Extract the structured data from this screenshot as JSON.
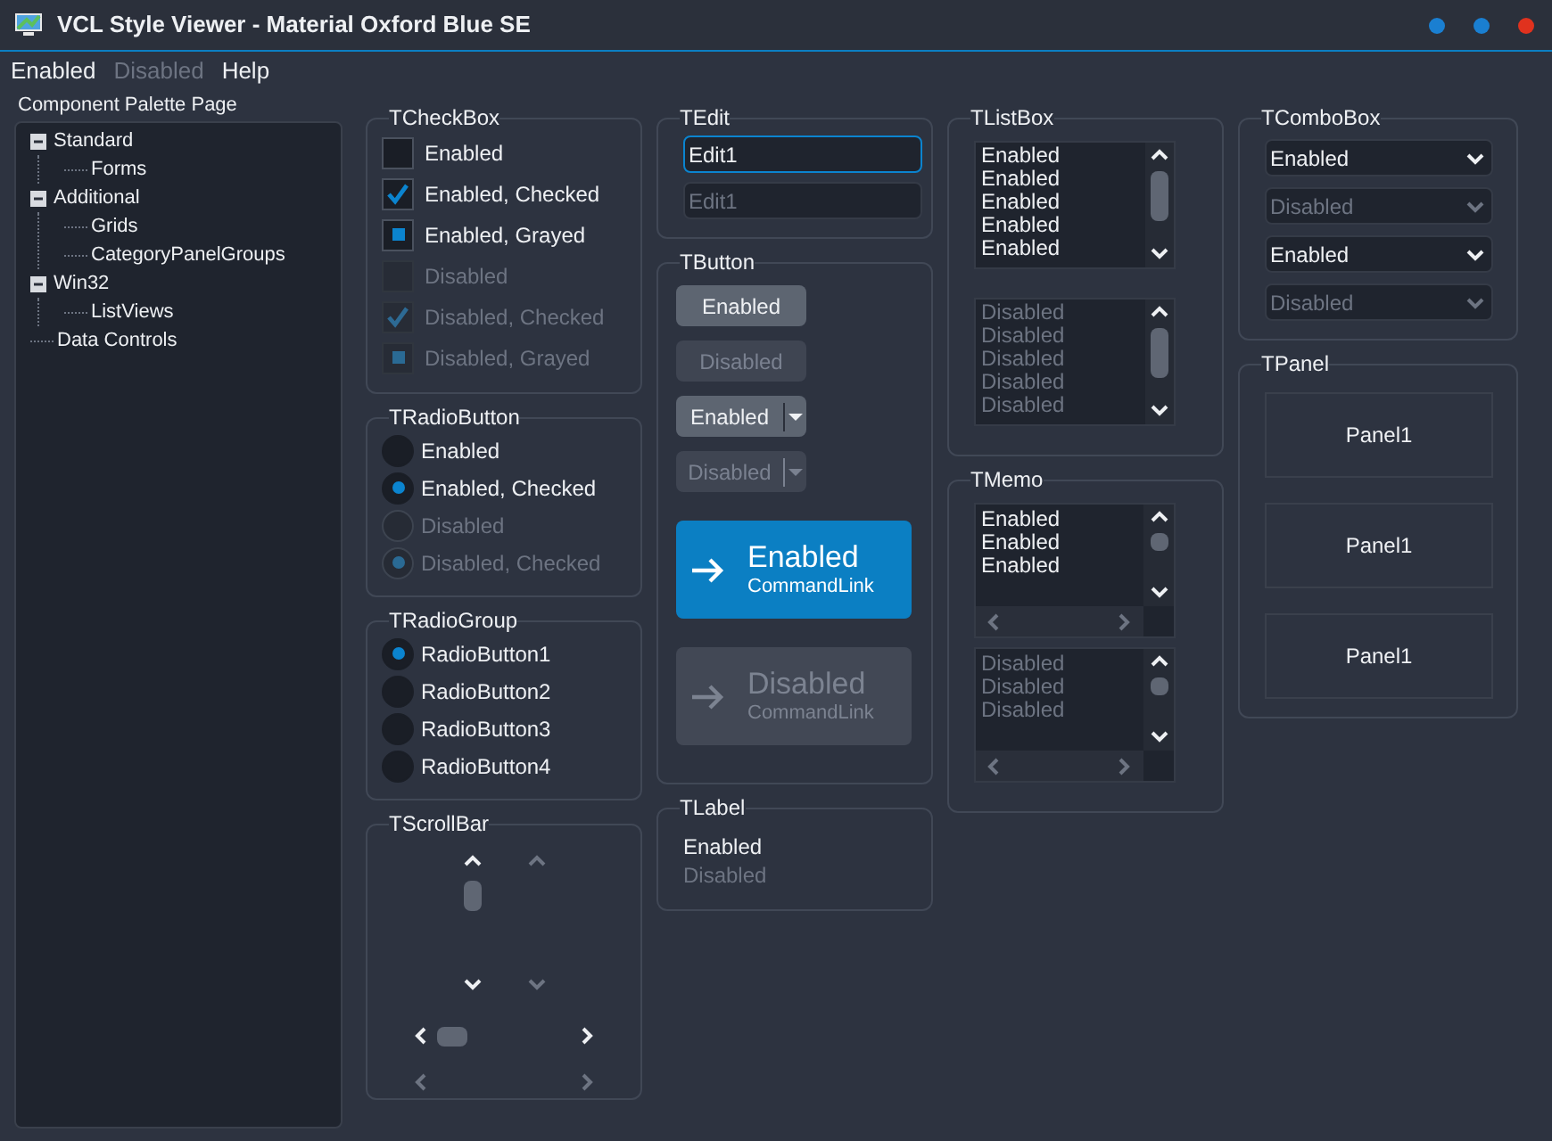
{
  "window": {
    "title": "VCL Style Viewer - Material Oxford Blue SE"
  },
  "menu": [
    {
      "label": "Enabled",
      "disabled": false
    },
    {
      "label": "Disabled",
      "disabled": true
    },
    {
      "label": "Help",
      "disabled": false
    }
  ],
  "palette": {
    "label": "Component Palette Page",
    "tree": [
      {
        "label": "Standard",
        "expanded": true,
        "children": [
          {
            "label": "Forms"
          }
        ]
      },
      {
        "label": "Additional",
        "expanded": true,
        "children": [
          {
            "label": "Grids"
          },
          {
            "label": "CategoryPanelGroups"
          }
        ]
      },
      {
        "label": "Win32",
        "expanded": true,
        "children": [
          {
            "label": "ListViews"
          }
        ]
      },
      {
        "label": "Data Controls"
      }
    ]
  },
  "checkbox_group": {
    "title": "TCheckBox",
    "items": [
      {
        "label": "Enabled",
        "checked": false,
        "grayed": false,
        "disabled": false
      },
      {
        "label": "Enabled, Checked",
        "checked": true,
        "grayed": false,
        "disabled": false
      },
      {
        "label": "Enabled, Grayed",
        "checked": false,
        "grayed": true,
        "disabled": false
      },
      {
        "label": "Disabled",
        "checked": false,
        "grayed": false,
        "disabled": true
      },
      {
        "label": "Disabled, Checked",
        "checked": true,
        "grayed": false,
        "disabled": true
      },
      {
        "label": "Disabled, Grayed",
        "checked": false,
        "grayed": true,
        "disabled": true
      }
    ]
  },
  "radiobutton_group": {
    "title": "TRadioButton",
    "items": [
      {
        "label": "Enabled",
        "checked": false,
        "disabled": false
      },
      {
        "label": "Enabled, Checked",
        "checked": true,
        "disabled": false
      },
      {
        "label": "Disabled",
        "checked": false,
        "disabled": true
      },
      {
        "label": "Disabled, Checked",
        "checked": true,
        "disabled": true
      }
    ]
  },
  "radio_group": {
    "title": "TRadioGroup",
    "items": [
      {
        "label": "RadioButton1",
        "selected": true
      },
      {
        "label": "RadioButton2",
        "selected": false
      },
      {
        "label": "RadioButton3",
        "selected": false
      },
      {
        "label": "RadioButton4",
        "selected": false
      }
    ]
  },
  "scrollbar_group": {
    "title": "TScrollBar",
    "vertical_bars": [
      {
        "disabled": false
      },
      {
        "disabled": true
      }
    ],
    "horizontal_bars": [
      {
        "disabled": false
      },
      {
        "disabled": true
      }
    ]
  },
  "edit_group": {
    "title": "TEdit",
    "fields": [
      {
        "value": "Edit1",
        "disabled": false,
        "focused": true
      },
      {
        "value": "Edit1",
        "disabled": true,
        "focused": false
      }
    ]
  },
  "button_group": {
    "title": "TButton",
    "buttons": [
      {
        "kind": "push",
        "label": "Enabled",
        "disabled": false
      },
      {
        "kind": "push",
        "label": "Disabled",
        "disabled": true
      },
      {
        "kind": "split",
        "label": "Enabled",
        "disabled": false
      },
      {
        "kind": "split",
        "label": "Disabled",
        "disabled": true
      },
      {
        "kind": "command_link",
        "label": "Enabled",
        "note": "CommandLink",
        "disabled": false
      },
      {
        "kind": "command_link",
        "label": "Disabled",
        "note": "CommandLink",
        "disabled": true
      }
    ]
  },
  "label_group": {
    "title": "TLabel",
    "labels": [
      {
        "text": "Enabled",
        "disabled": false
      },
      {
        "text": "Disabled",
        "disabled": true
      }
    ]
  },
  "listbox_group": {
    "title": "TListBox",
    "lists": [
      {
        "disabled": false,
        "items": [
          "Enabled",
          "Enabled",
          "Enabled",
          "Enabled",
          "Enabled"
        ]
      },
      {
        "disabled": true,
        "items": [
          "Disabled",
          "Disabled",
          "Disabled",
          "Disabled",
          "Disabled"
        ]
      }
    ]
  },
  "memo_group": {
    "title": "TMemo",
    "memos": [
      {
        "disabled": false,
        "lines": [
          "Enabled",
          "Enabled",
          "Enabled"
        ]
      },
      {
        "disabled": true,
        "lines": [
          "Disabled",
          "Disabled",
          "Disabled"
        ]
      }
    ]
  },
  "combobox_group": {
    "title": "TComboBox",
    "combos": [
      {
        "value": "Enabled",
        "disabled": false
      },
      {
        "value": "Disabled",
        "disabled": true
      },
      {
        "value": "Enabled",
        "disabled": false
      },
      {
        "value": "Disabled",
        "disabled": true
      }
    ]
  },
  "panel_group": {
    "title": "TPanel",
    "panels": [
      {
        "caption": "Panel1"
      },
      {
        "caption": "Panel1"
      },
      {
        "caption": "Panel1"
      }
    ]
  }
}
